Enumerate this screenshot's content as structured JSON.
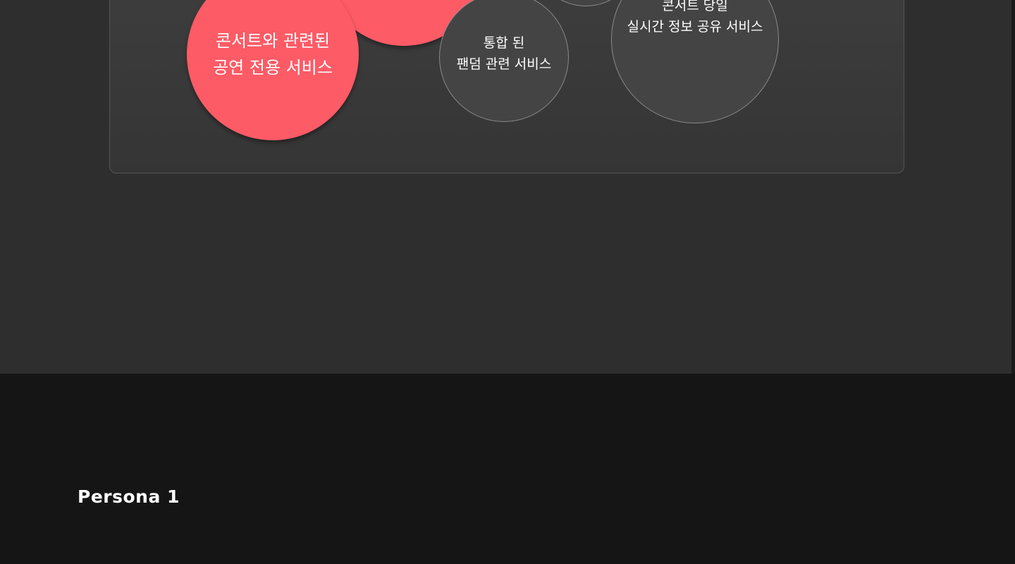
{
  "service_bubbles": [
    {
      "label": "콘서트와 관련된\n공연 전용 서비스",
      "style": "highlighted",
      "color": "#fd5b66"
    },
    {
      "label": "",
      "style": "highlighted",
      "color": "#fd5b66"
    },
    {
      "label": "",
      "style": "outline",
      "color": "#444444"
    },
    {
      "label": "통합 된\n팬덤 관련 서비스",
      "style": "outline",
      "color": "#444444"
    },
    {
      "label": "콘서트 당일\n실시간 정보 공유 서비스",
      "style": "outline",
      "color": "#444444"
    }
  ],
  "persona_section": {
    "title": "Persona 1"
  },
  "colors": {
    "accent": "#fd5b66",
    "upper_background": "#2e2e2e",
    "lower_background": "#151515",
    "panel_background": "#3a3a3a"
  }
}
